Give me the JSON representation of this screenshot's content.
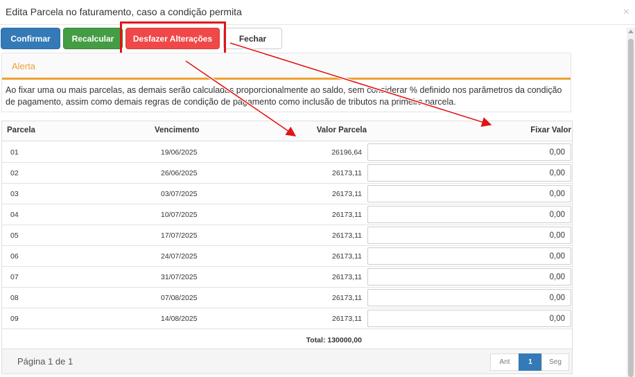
{
  "modal": {
    "title": "Edita Parcela no faturamento, caso a condição permita",
    "close_glyph": "×"
  },
  "toolbar": {
    "confirmar_label": "Confirmar",
    "recalcular_label": "Recalcular",
    "desfazer_label": "Desfazer Alterações",
    "fechar_label": "Fechar"
  },
  "alert": {
    "title": "Alerta",
    "body": "Ao fixar uma ou mais parcelas, as demais serão calculadas proporcionalmente ao saldo, sem considerar % definido nos parâmetros da condição de pagamento, assim como demais regras de condição de pagamento como inclusão de tributos na primeira parcela."
  },
  "table": {
    "headers": {
      "parcela": "Parcela",
      "vencimento": "Vencimento",
      "valor": "Valor Parcela",
      "fixar": "Fixar Valor"
    },
    "rows": [
      {
        "parcela": "01",
        "vencimento": "19/06/2025",
        "valor": "26196,64",
        "fixar": "0,00"
      },
      {
        "parcela": "02",
        "vencimento": "26/06/2025",
        "valor": "26173,11",
        "fixar": "0,00"
      },
      {
        "parcela": "03",
        "vencimento": "03/07/2025",
        "valor": "26173,11",
        "fixar": "0,00"
      },
      {
        "parcela": "04",
        "vencimento": "10/07/2025",
        "valor": "26173,11",
        "fixar": "0,00"
      },
      {
        "parcela": "05",
        "vencimento": "17/07/2025",
        "valor": "26173,11",
        "fixar": "0,00"
      },
      {
        "parcela": "06",
        "vencimento": "24/07/2025",
        "valor": "26173,11",
        "fixar": "0,00"
      },
      {
        "parcela": "07",
        "vencimento": "31/07/2025",
        "valor": "26173,11",
        "fixar": "0,00"
      },
      {
        "parcela": "08",
        "vencimento": "07/08/2025",
        "valor": "26173,11",
        "fixar": "0,00"
      },
      {
        "parcela": "09",
        "vencimento": "14/08/2025",
        "valor": "26173,11",
        "fixar": "0,00"
      }
    ],
    "total": "Total: 130000,00"
  },
  "pager": {
    "info": "Página 1 de 1",
    "prev": "Ant",
    "current": "1",
    "next": "Seg"
  },
  "colors": {
    "primary": "#337ab7",
    "success": "#449d44",
    "danger": "#f04848",
    "alert_accent": "#f0a030",
    "annotation": "#e11414"
  }
}
